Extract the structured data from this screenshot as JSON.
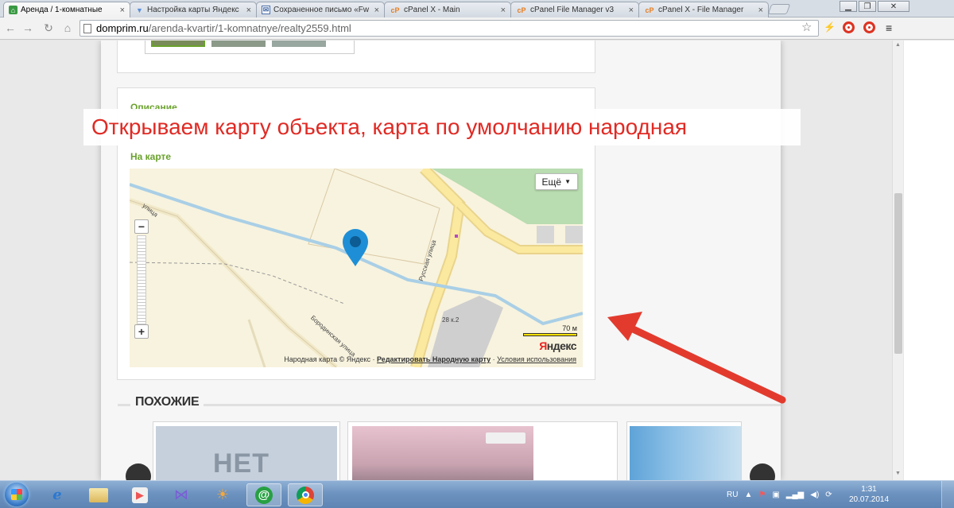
{
  "browser": {
    "tabs": [
      {
        "title": "Аренда / 1-комнатные",
        "favicon": "site-green-icon",
        "active": true
      },
      {
        "title": "Настройка карты Яндекс",
        "favicon": "yandex-icon",
        "active": false
      },
      {
        "title": "Сохраненное письмо «Fw",
        "favicon": "mail-icon",
        "active": false
      },
      {
        "title": "cPanel X - Main",
        "favicon": "cpanel-icon",
        "active": false
      },
      {
        "title": "cPanel File Manager v3",
        "favicon": "cpanel-icon",
        "active": false
      },
      {
        "title": "cPanel X - File Manager",
        "favicon": "cpanel-icon",
        "active": false
      }
    ],
    "close_glyph": "×",
    "url_host": "domprim.ru",
    "url_path": "/arenda-kvartir/1-komnatnye/realty2559.html"
  },
  "page": {
    "description_label": "Описание",
    "map_label": "На карте",
    "map": {
      "more_button": "Ещё",
      "zoom_in": "+",
      "zoom_out": "−",
      "scale": "70 м",
      "logo": "Яндекс",
      "copyright_prefix": "Народная карта © Яндекс · ",
      "edit_link": "Редактировать Народную карту",
      "separator": " · ",
      "terms_link": "Условия использования",
      "street_1": "Русская улица",
      "street_2": "Бородинская улица",
      "street_3": "улица",
      "house_number": "28 к.2"
    },
    "similar_title": "ПОХОЖИЕ",
    "no_image_text": "НЕТ"
  },
  "overlay_caption": "Открываем карту объекта, карта по умолчанию народная",
  "taskbar": {
    "language": "RU",
    "time": "1:31",
    "date": "20.07.2014"
  },
  "colors": {
    "accent_green": "#6aa12c",
    "caption_red": "#e02a24",
    "arrow_red": "#e23b2e",
    "map_pin": "#1e8fd6"
  }
}
